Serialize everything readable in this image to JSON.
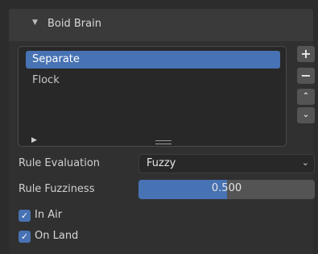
{
  "panel": {
    "title": "Boid Brain",
    "collapse_icon": "triangle-down-icon"
  },
  "rules_list": {
    "items": [
      {
        "label": "Separate",
        "selected": true
      },
      {
        "label": "Flock",
        "selected": false
      }
    ],
    "footer_icon": "triangle-right-icon",
    "resize_icon": "resize-handle-icon"
  },
  "side_buttons": {
    "add": "+",
    "remove": "−",
    "move_up": "⌃",
    "move_down": "⌄"
  },
  "rule_evaluation": {
    "label": "Rule Evaluation",
    "value": "Fuzzy",
    "arrow": "⌄"
  },
  "rule_fuzziness": {
    "label": "Rule Fuzziness",
    "value": "0.500",
    "fraction": 0.5
  },
  "checkboxes": [
    {
      "label": "In Air",
      "checked": true
    },
    {
      "label": "On Land",
      "checked": true
    }
  ],
  "colors": {
    "accent": "#4772b3",
    "background": "#2c2c2c"
  }
}
